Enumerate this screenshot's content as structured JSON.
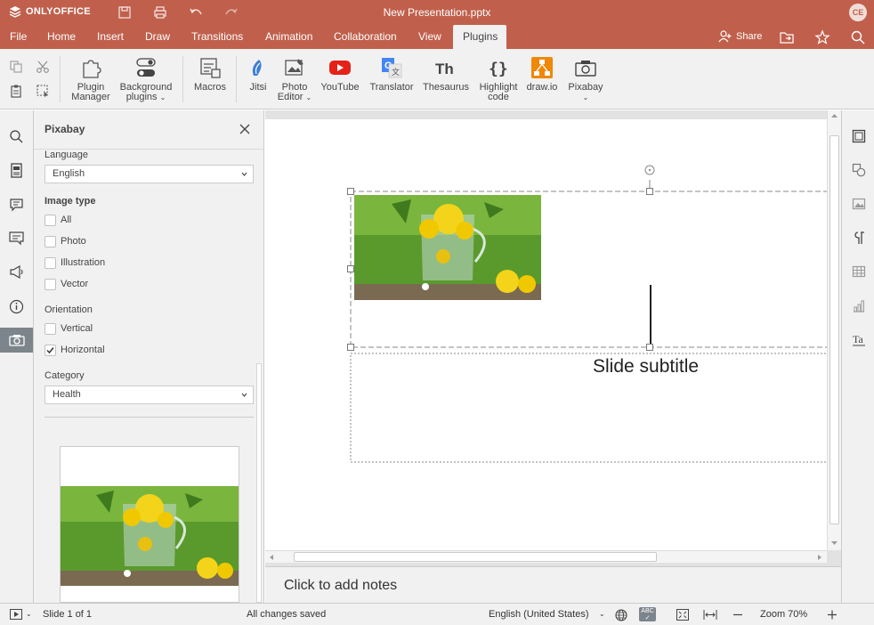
{
  "app": {
    "brand": "ONLYOFFICE",
    "doc_title": "New Presentation.pptx",
    "user_initials": "CE"
  },
  "menu": {
    "tabs": [
      "File",
      "Home",
      "Insert",
      "Draw",
      "Transitions",
      "Animation",
      "Collaboration",
      "View",
      "Plugins"
    ],
    "active_tab": "Plugins",
    "share_label": "Share"
  },
  "toolbar": {
    "plugin_manager": [
      "Plugin",
      "Manager"
    ],
    "background_plugins": [
      "Background",
      "plugins"
    ],
    "macros": "Macros",
    "jitsi": "Jitsi",
    "photo_editor": [
      "Photo",
      "Editor"
    ],
    "youtube": "YouTube",
    "translator": "Translator",
    "thesaurus": "Thesaurus",
    "highlight_code": [
      "Highlight",
      "code"
    ],
    "drawio": "draw.io",
    "pixabay": "Pixabay"
  },
  "panel": {
    "title": "Pixabay",
    "language_label": "Language",
    "language_value": "English",
    "image_type_label": "Image type",
    "image_types": [
      {
        "label": "All",
        "checked": false
      },
      {
        "label": "Photo",
        "checked": false
      },
      {
        "label": "Illustration",
        "checked": false
      },
      {
        "label": "Vector",
        "checked": false
      }
    ],
    "orientation_label": "Orientation",
    "orientations": [
      {
        "label": "Vertical",
        "checked": false
      },
      {
        "label": "Horizontal",
        "checked": true
      }
    ],
    "category_label": "Category",
    "category_value": "Health"
  },
  "slide": {
    "subtitle": "Slide subtitle"
  },
  "notes": {
    "placeholder": "Click to add notes"
  },
  "status": {
    "slide_counter": "Slide 1 of 1",
    "save_state": "All changes saved",
    "language": "English (United States)",
    "zoom": "Zoom 70%"
  },
  "colors": {
    "accent": "#c0604c",
    "toolbar_bg": "#f1f1f1"
  }
}
